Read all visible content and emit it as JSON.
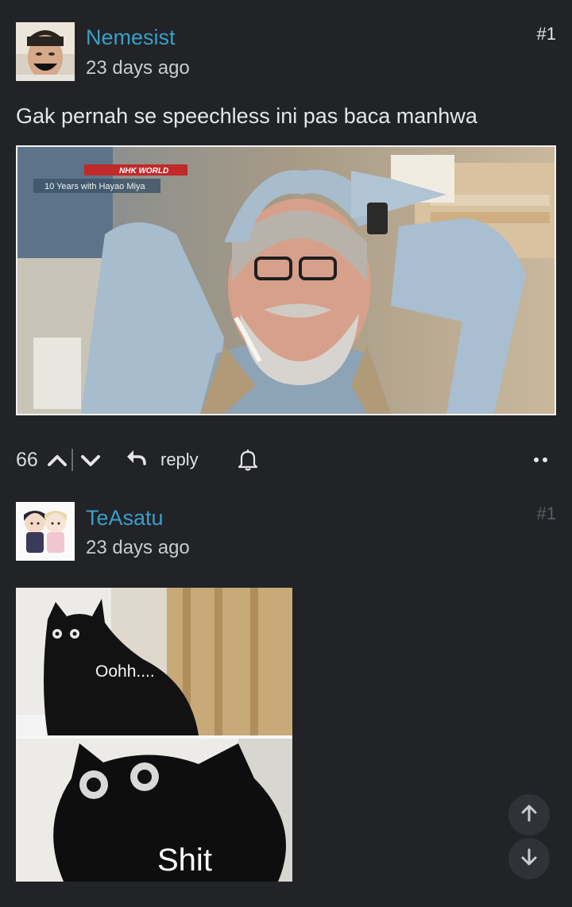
{
  "comments": [
    {
      "username": "Nemesist",
      "time": "23 days ago",
      "number": "#1",
      "text": "Gak pernah se speechless ini pas baca manhwa",
      "image": {
        "channel": "NHK WORLD",
        "caption": "10 Years with Hayao Miya"
      },
      "votes": "66",
      "reply_label": "reply"
    },
    {
      "username": "TeAsatu",
      "time": "23 days ago",
      "number": "#1",
      "image": {
        "top_text": "Oohh....",
        "bottom_text": "Shit"
      }
    }
  ],
  "icons": {
    "upvote": "chevron-up-icon",
    "downvote": "chevron-down-icon",
    "reply": "reply-arrow-icon",
    "bell": "bell-icon",
    "more": "more-dots-icon",
    "scroll_up": "arrow-up-icon",
    "scroll_down": "arrow-down-icon"
  },
  "colors": {
    "background": "#212327",
    "username": "#3a9fc8",
    "text": "#e4e6ea"
  }
}
